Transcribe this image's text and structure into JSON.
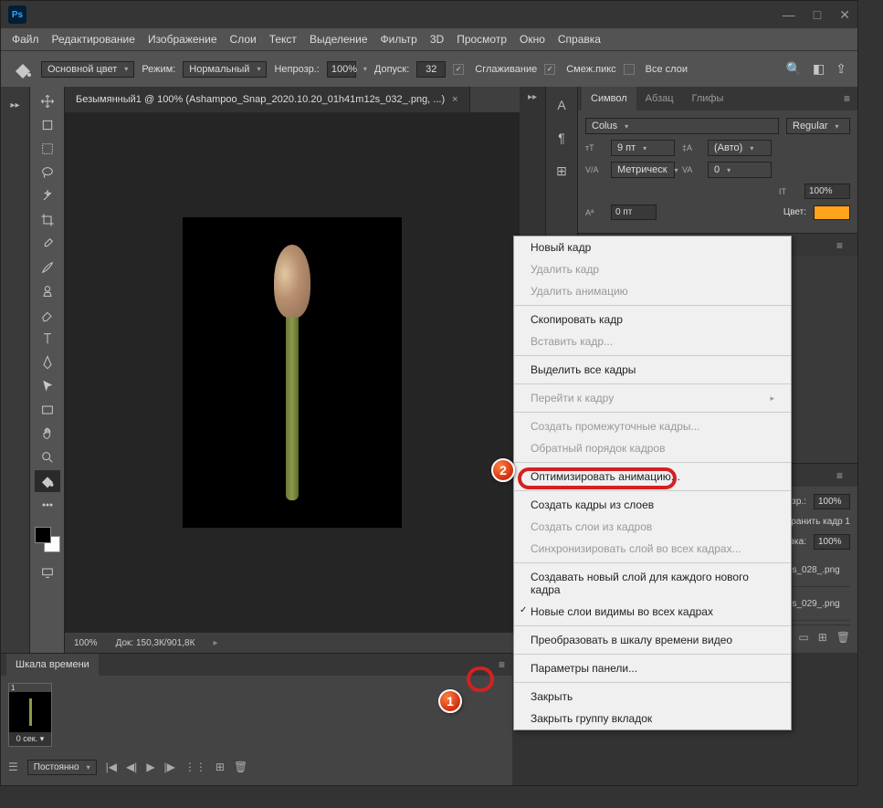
{
  "menubar": {
    "file": "Файл",
    "edit": "Редактирование",
    "image": "Изображение",
    "layer": "Слои",
    "type": "Текст",
    "select": "Выделение",
    "filter": "Фильтр",
    "threed": "3D",
    "view": "Просмотр",
    "window": "Окно",
    "help": "Справка"
  },
  "optbar": {
    "foreground": "Основной цвет",
    "mode_label": "Режим:",
    "mode_value": "Нормальный",
    "opacity_label": "Непрозр.:",
    "opacity_value": "100%",
    "tolerance_label": "Допуск:",
    "tolerance_value": "32",
    "antialias": "Сглаживание",
    "contiguous": "Смеж.пикс",
    "all_layers": "Все слои"
  },
  "document": {
    "tab_title": "Безымянный1 @ 100% (Ashampoo_Snap_2020.10.20_01h41m12s_032_.png, ...)",
    "zoom": "100%",
    "doc_size": "Док: 150,3К/901,8К"
  },
  "char_panel": {
    "tab_symbol": "Символ",
    "tab_paragraph": "Абзац",
    "tab_glyphs": "Глифы",
    "font": "Colus",
    "style": "Regular",
    "size": "9 пт",
    "leading": "(Авто)",
    "kerning": "Метрическ",
    "tracking": "0",
    "vscale": "100%",
    "baseline": "0 пт",
    "color_label": "Цвет:",
    "color": "#ffa31a"
  },
  "layers": {
    "opacity_label": "Непрозр.:",
    "opacity_value": "100%",
    "fill_label": "Заливка:",
    "fill_value": "100%",
    "extra_text": "ранить кадр 1",
    "items": [
      {
        "name": "Ashampoo_Snap_2020...._01h40m41s_028_.png"
      },
      {
        "name": "Ashampoo_Snap_2020...._01h40m51s_029_.png"
      }
    ]
  },
  "timeline": {
    "tab": "Шкала времени",
    "frame_num": "1",
    "frame_delay": "0 сек.",
    "loop": "Постоянно"
  },
  "context_menu": {
    "new_frame": "Новый кадр",
    "delete_frame": "Удалить кадр",
    "delete_anim": "Удалить анимацию",
    "copy_frame": "Скопировать кадр",
    "paste_frame": "Вставить кадр...",
    "select_all": "Выделить все кадры",
    "goto_frame": "Перейти к кадру",
    "tween": "Создать промежуточные кадры...",
    "reverse": "Обратный порядок кадров",
    "optimize": "Оптимизировать анимацию...",
    "make_frames": "Создать кадры из слоев",
    "flatten": "Создать слои из кадров",
    "match": "Синхронизировать слой во всех кадрах...",
    "new_layer_each": "Создавать новый слой для каждого нового кадра",
    "visible_all": "Новые слои видимы во всех кадрах",
    "convert": "Преобразовать в шкалу времени видео",
    "panel_opts": "Параметры панели...",
    "close": "Закрыть",
    "close_group": "Закрыть группу вкладок"
  },
  "markers": {
    "one": "1",
    "two": "2"
  }
}
